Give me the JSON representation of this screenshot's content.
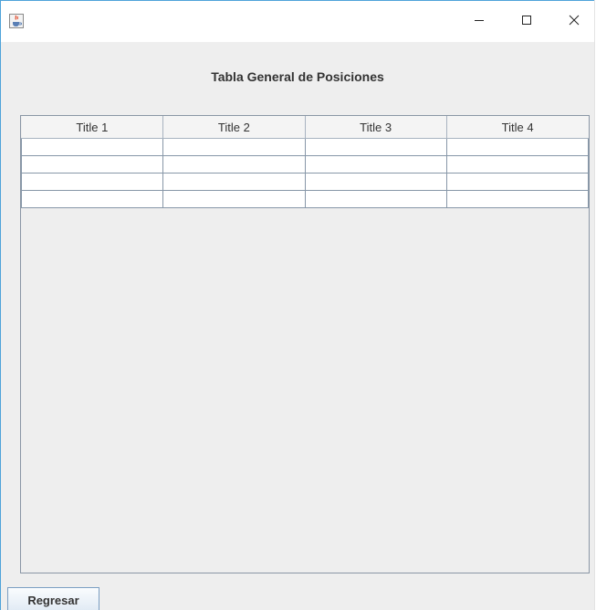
{
  "window": {
    "minimize_icon": "minimize-icon",
    "maximize_icon": "maximize-icon",
    "close_icon": "close-icon",
    "app_icon": "java-cup-icon"
  },
  "heading": "Tabla General de Posiciones",
  "table": {
    "columns": [
      "Title 1",
      "Title 2",
      "Title 3",
      "Title 4"
    ],
    "rows": [
      [
        "",
        "",
        "",
        ""
      ],
      [
        "",
        "",
        "",
        ""
      ],
      [
        "",
        "",
        "",
        ""
      ],
      [
        "",
        "",
        "",
        ""
      ]
    ]
  },
  "back_button": "Regresar",
  "colors": {
    "accent_border": "#4fa3d9",
    "panel_background": "#eeeeee"
  }
}
